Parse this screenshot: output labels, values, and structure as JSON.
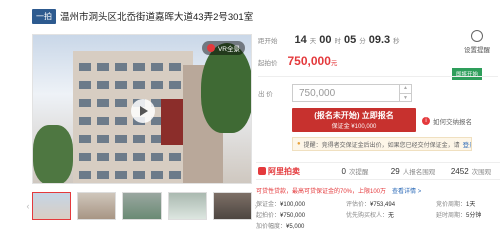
{
  "header": {
    "tag": "一拍",
    "title": "温州市洞头区北岙街道嘉晖大道43弄2号301室"
  },
  "photo": {
    "vr_label": "VR全景",
    "thumbnail_count": 5
  },
  "countdown": {
    "label": "距开始",
    "days": "14",
    "days_unit": "天",
    "hours": "00",
    "hours_unit": "时",
    "minutes": "05",
    "minutes_unit": "分",
    "seconds": "09.3",
    "seconds_unit": "秒"
  },
  "remind": {
    "label": "设置提醒"
  },
  "start": {
    "label": "起拍价",
    "price": "750,000",
    "unit": "元"
  },
  "ribbon": "即将开始",
  "bid": {
    "label": "出 价",
    "value": "750,000",
    "up": "▲",
    "down": "▼"
  },
  "register": {
    "line1": "(报名未开始) 立即报名",
    "line2": "保证金 ¥100,000",
    "howto": "如何交纳报名"
  },
  "warn": {
    "text": "提醒：竞得者交保证金后出价，如果您已经交付保证金，请",
    "login": "登录"
  },
  "stats": {
    "logo": "阿里拍卖",
    "s1_num": "0",
    "s1_label": "次提醒",
    "s2_num": "29",
    "s2_label": "人报名围观",
    "s3_num": "2452",
    "s3_label": "次围观"
  },
  "notice": {
    "text": "可贷性贷款，最高可贷保证金的70%，上限100万",
    "detail": "查看详情 >"
  },
  "info": [
    {
      "label": "保证金：",
      "value": "¥100,000"
    },
    {
      "label": "评估价：",
      "value": "¥753,494"
    },
    {
      "label": "竞价周期：",
      "value": "1天"
    },
    {
      "label": "起拍价：",
      "value": "¥750,000"
    },
    {
      "label": "优先购买权人：",
      "value": "无"
    },
    {
      "label": "延时周期：",
      "value": "5分钟"
    },
    {
      "label": "加价幅度：",
      "value": "¥5,000"
    }
  ],
  "colors": {
    "accent": "#e4393c",
    "tag_bg": "#2d5a8f",
    "link": "#2d6bb8"
  }
}
